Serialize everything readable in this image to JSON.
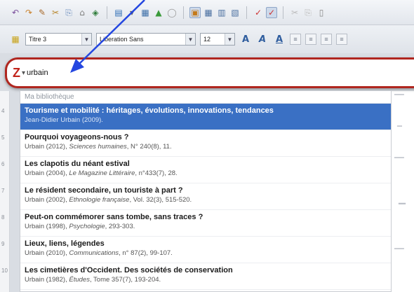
{
  "toolbar_row1": {
    "icons": [
      "undo-icon",
      "redo-icon",
      "rename-icon",
      "cut-icon",
      "copy-icon",
      "paste-icon",
      "navigator-icon",
      "hyperlink-icon",
      "image-icon",
      "chart-icon",
      "shape-icon",
      "edit-mode-icon",
      "formatting-marks-icon",
      "table-icon",
      "spellcheck-icon",
      "autospell-icon",
      "track-changes-icon",
      "cut2-icon",
      "clone-icon"
    ]
  },
  "toolbar_row2": {
    "paragraph_style": "Titre 3",
    "font_name": "Liberation Sans",
    "font_size": "12"
  },
  "zotero_bar": {
    "logo": "Z",
    "caret": "▾",
    "query": "urbain"
  },
  "ruler": {
    "numbers": [
      "4",
      "5",
      "6",
      "7",
      "8",
      "9",
      "10"
    ]
  },
  "results": {
    "section_label": "Ma bibliothèque",
    "items": [
      {
        "title": "Tourisme et mobilité : héritages, évolutions, innovations, tendances",
        "meta_plain": "Jean-Didier Urbain (2009).",
        "meta_italic": "",
        "meta_tail": ""
      },
      {
        "title": "Pourquoi voyageons-nous ?",
        "meta_plain": "Urbain (2012), ",
        "meta_italic": "Sciences humaines",
        "meta_tail": ", N° 240(8), 11."
      },
      {
        "title": "Les clapotis du néant estival",
        "meta_plain": "Urbain (2004), ",
        "meta_italic": "Le Magazine Littéraire",
        "meta_tail": ", n°433(7), 28."
      },
      {
        "title": "Le résident secondaire, un touriste à part ?",
        "meta_plain": "Urbain (2002), ",
        "meta_italic": "Ethnologie française",
        "meta_tail": ", Vol. 32(3), 515-520."
      },
      {
        "title": "Peut-on commémorer sans tombe, sans traces ?",
        "meta_plain": "Urbain (1998), ",
        "meta_italic": "Psychologie",
        "meta_tail": ", 293-303."
      },
      {
        "title": "Lieux, liens, légendes",
        "meta_plain": "Urbain (2010), ",
        "meta_italic": "Communications",
        "meta_tail": ", n° 87(2), 99-107."
      },
      {
        "title": "Les cimetières d'Occident. Des sociétés de conservation",
        "meta_plain": "Urbain (1982), ",
        "meta_italic": "Études",
        "meta_tail": ", Tome 357(7), 193-204."
      }
    ]
  },
  "colors": {
    "accent_red": "#b0261f",
    "selection_blue": "#3a70c4",
    "arrow_blue": "#2447e0"
  }
}
